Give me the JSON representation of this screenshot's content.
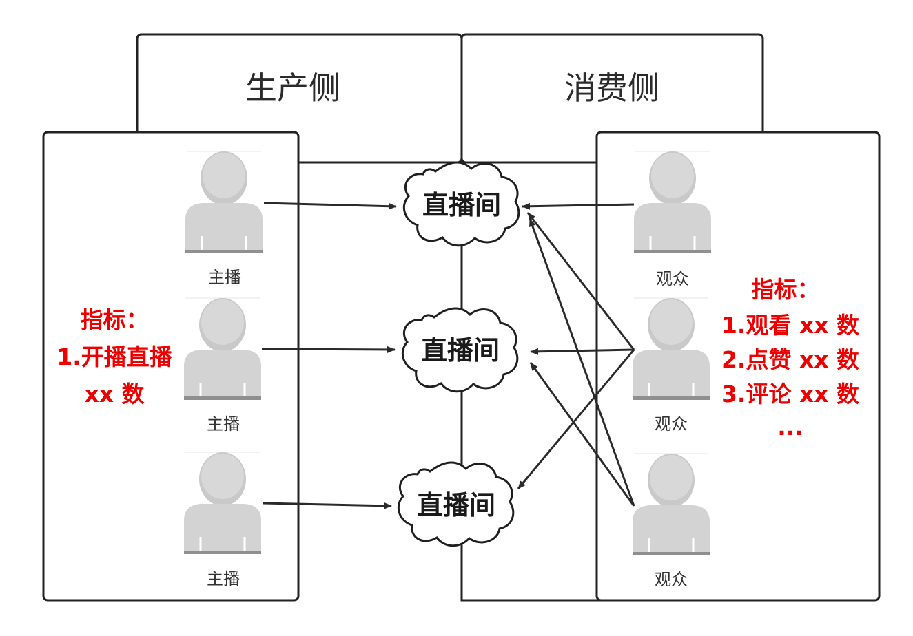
{
  "producer_side": {
    "title": "生产侧",
    "anchors": [
      {
        "label": "主播"
      },
      {
        "label": "主播"
      },
      {
        "label": "主播"
      }
    ],
    "metrics": [
      "指标：",
      "1.开播直播",
      "xx 数"
    ]
  },
  "consumer_side": {
    "title": "消费侧",
    "viewers": [
      {
        "label": "观众"
      },
      {
        "label": "观众"
      },
      {
        "label": "观众"
      }
    ],
    "metrics": [
      "指标：",
      "1.观看 xx 数",
      "2.点赞 xx 数",
      "3.评论 xx 数",
      "..."
    ]
  },
  "live_rooms": [
    {
      "label": "直播间"
    },
    {
      "label": "直播间"
    },
    {
      "label": "直播间"
    }
  ],
  "colors": {
    "metric_text": "#ee0000",
    "box_stroke": "#222222",
    "person_fill": "#d3d3d3",
    "arrow": "#2a2a2a"
  }
}
